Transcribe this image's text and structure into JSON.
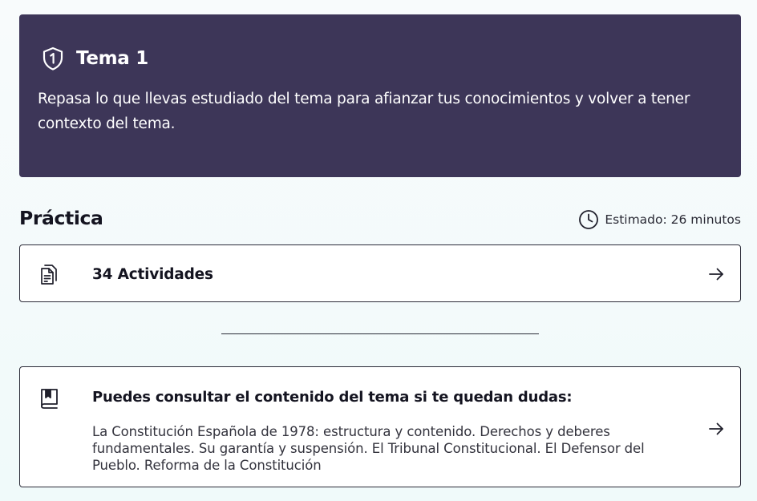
{
  "hero": {
    "title": "Tema 1",
    "description": "Repasa lo que llevas estudiado del tema para afianzar tus conocimientos y volver a tener contexto del tema.",
    "icon": "shield-number-one-icon",
    "background": "#3d3658"
  },
  "practice": {
    "title": "Práctica",
    "estimate": "Estimado: 26 minutos",
    "estimate_icon": "clock-icon"
  },
  "activities_card": {
    "label": "34 Actividades",
    "icon": "documents-icon",
    "action_icon": "arrow-right-icon"
  },
  "content_card": {
    "heading": "Puedes consultar el contenido del tema si te quedan dudas:",
    "description": "La Constitución Española de 1978: estructura y contenido. Derechos y deberes fundamentales. Su garantía y suspensión. El Tribunal Constitucional. El Defensor del Pueblo. Reforma de la Constitución",
    "icon": "book-icon",
    "action_icon": "arrow-right-icon"
  }
}
